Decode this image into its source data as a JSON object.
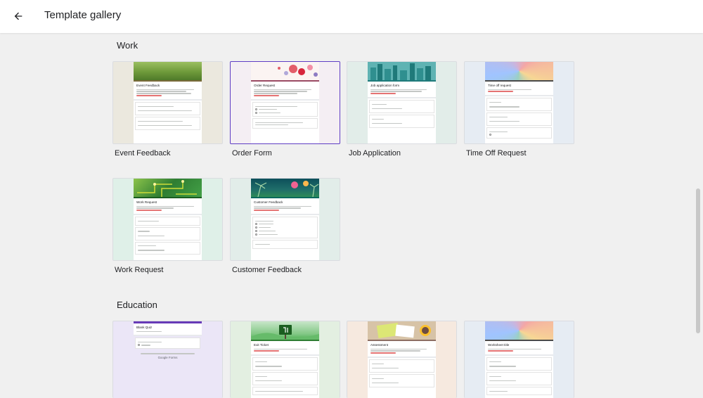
{
  "header": {
    "title": "Template gallery",
    "back_icon": "arrow-back-icon"
  },
  "sections": {
    "work": {
      "title": "Work",
      "templates": [
        {
          "label": "Event Feedback",
          "doc_title": "Event Feedback"
        },
        {
          "label": "Order Form",
          "doc_title": "Order Request"
        },
        {
          "label": "Job Application",
          "doc_title": "Job application form"
        },
        {
          "label": "Time Off Request",
          "doc_title": "Time off request"
        },
        {
          "label": "Work Request",
          "doc_title": "Work Request"
        },
        {
          "label": "Customer Feedback",
          "doc_title": "Customer Feedback"
        }
      ]
    },
    "education": {
      "title": "Education",
      "templates": [
        {
          "label": "",
          "doc_title": "Blank Quiz",
          "footer": "Google Forms"
        },
        {
          "label": "",
          "doc_title": "Exit Ticket"
        },
        {
          "label": "",
          "doc_title": "Assessment"
        },
        {
          "label": "",
          "doc_title": "Worksheet title"
        }
      ]
    }
  },
  "colors": {
    "selected_border": "#5f3dc4",
    "page_bg": "#f0f0f0"
  }
}
